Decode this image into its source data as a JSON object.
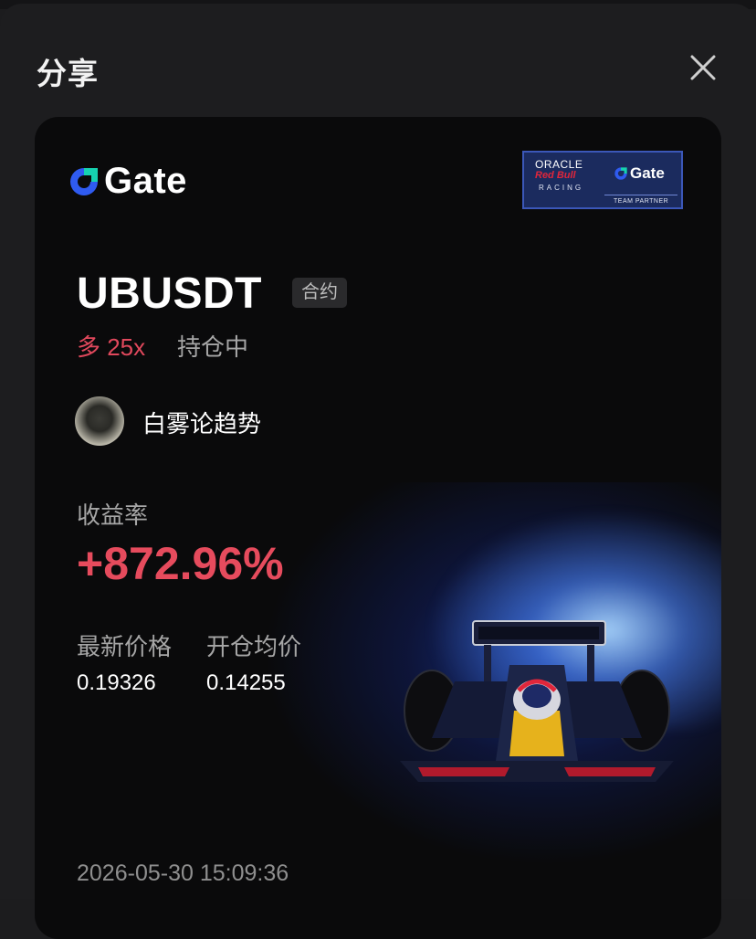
{
  "sheet": {
    "title": "分享"
  },
  "card": {
    "brand": "Gate",
    "partner_badge": {
      "line1": "ORACLE",
      "line2": "Red Bull",
      "line3": "RACING",
      "brand": "Gate",
      "sub": "TEAM PARTNER"
    },
    "symbol": "UBUSDT",
    "tag": "合约",
    "side": "多 25x",
    "status": "持仓中",
    "username": "白雾论趋势",
    "roi_label": "收益率",
    "roi_value": "+872.96%",
    "latest_price_label": "最新价格",
    "latest_price": "0.19326",
    "open_price_label": "开仓均价",
    "open_price": "0.14255",
    "timestamp": "2026-05-30 15:09:36"
  },
  "colors": {
    "accent_blue": "#2f5bf0",
    "profit_red": "#e64b5d"
  },
  "icons": {
    "close": "close-icon",
    "logo": "gate-logo-icon",
    "car": "race-car-image"
  }
}
